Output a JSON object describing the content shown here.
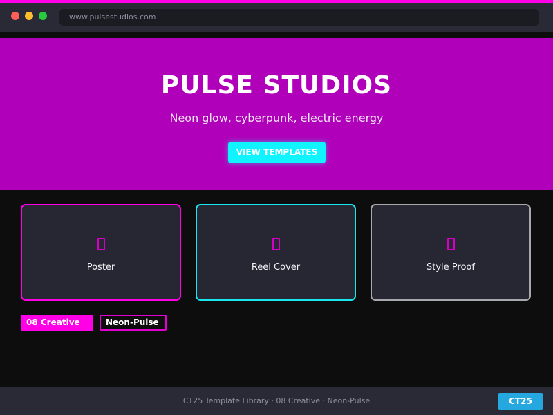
{
  "browser": {
    "url": "www.pulsestudios.com"
  },
  "hero": {
    "title": "PULSE STUDIOS",
    "subtitle": "Neon glow, cyberpunk, electric energy",
    "cta_label": "VIEW TEMPLATES"
  },
  "cards": [
    {
      "label": "Poster",
      "icon": "document-icon",
      "border_color": "#ff00e6"
    },
    {
      "label": "Reel Cover",
      "icon": "document-icon",
      "border_color": "#19e6ee"
    },
    {
      "label": "Style Proof",
      "icon": "document-icon",
      "border_color": "#a9a9ad"
    }
  ],
  "tags": {
    "category": "08 Creative",
    "theme": "Neon-Pulse"
  },
  "footer": {
    "text": "CT25 Template Library · 08 Creative · Neon-Pulse",
    "badge": "CT25"
  },
  "colors": {
    "accent_magenta": "#ff00e6",
    "hero_background": "#b100b9",
    "accent_cyan": "#0ff4ff",
    "badge_blue": "#25a8e0"
  }
}
